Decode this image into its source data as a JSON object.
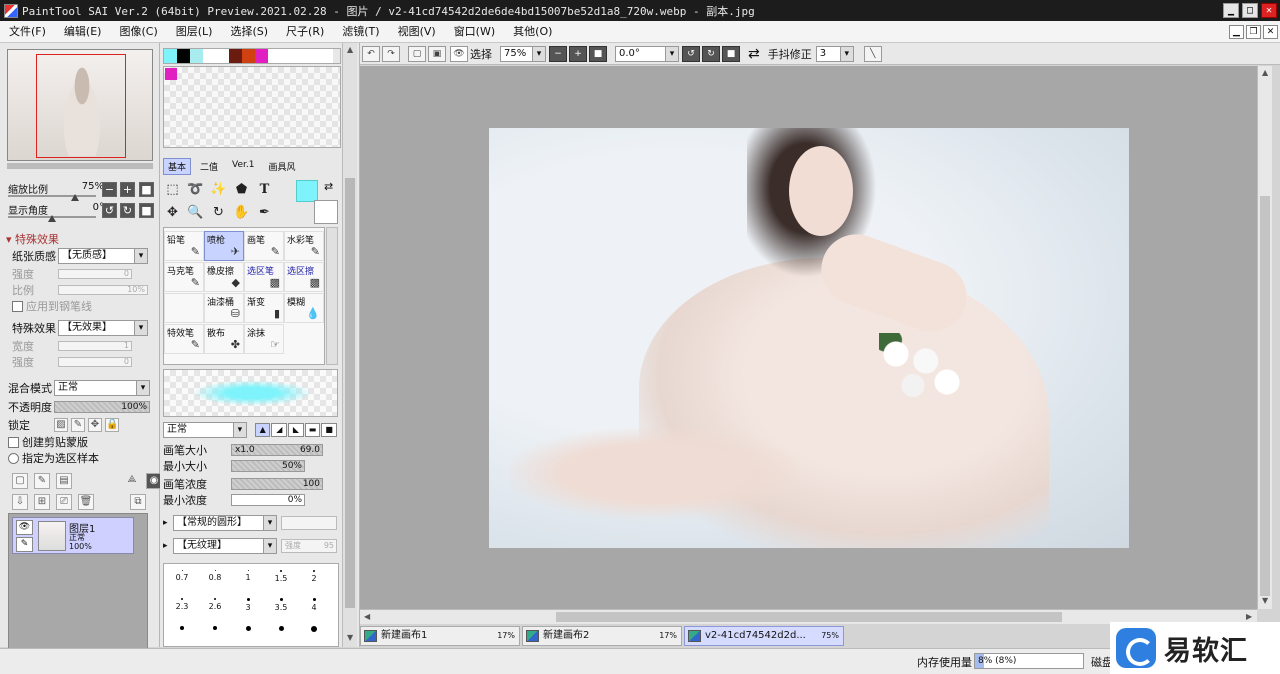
{
  "window": {
    "title": "PaintTool SAI Ver.2 (64bit) Preview.2021.02.28 - 图片 / v2-41cd74542d2de6de4bd15007be52d1a8_720w.webp - 副本.jpg",
    "minimize": "▁",
    "maximize": "□",
    "close": "✕"
  },
  "menu": {
    "items": [
      "文件(F)",
      "编辑(E)",
      "图像(C)",
      "图层(L)",
      "选择(S)",
      "尺子(R)",
      "滤镜(T)",
      "视图(V)",
      "窗口(W)",
      "其他(O)"
    ]
  },
  "navigator": {
    "zoom_label": "缩放比例",
    "zoom_value": "75%",
    "zoom_level": 0.75,
    "angle_label": "显示角度",
    "angle_value": "0°"
  },
  "effects": {
    "section_title": "特殊效果",
    "paper_label": "纸张质感",
    "paper_value": "【无质感】",
    "strength_label": "强度",
    "strength_value": "0",
    "scale_label": "比例",
    "scale_value": "10%",
    "apply_pen_label": "应用到钢笔线",
    "effect_label": "特殊效果",
    "effect_value": "【无效果】",
    "width_label": "宽度",
    "width_value": "1",
    "effect_strength_label": "强度",
    "effect_strength_value": "0"
  },
  "layer_props": {
    "blend_label": "混合模式",
    "blend_value": "正常",
    "opacity_label": "不透明度",
    "opacity_value": "100%",
    "opacity_level": 1.0,
    "lock_label": "锁定",
    "clip_label": "创建剪贴蒙版",
    "sample_label": "指定为选区样本"
  },
  "layers": [
    {
      "name": "图层1",
      "mode": "正常",
      "opacity": "100%"
    }
  ],
  "palette": {
    "colors": [
      "#7ff3fb",
      "#000000",
      "#a8ecf0",
      "#ffffff",
      "#ffffff",
      "#6a1c10",
      "#d04010",
      "#e020c0",
      "#ffffff",
      "#ffffff",
      "#ffffff",
      "#ffffff",
      "#ffffff"
    ]
  },
  "tool_tabs": [
    "基本",
    "二值",
    "Ver.1",
    "画具风"
  ],
  "brushes": [
    {
      "label": "铅笔",
      "icon": "✎"
    },
    {
      "label": "喷枪",
      "icon": "✈"
    },
    {
      "label": "画笔",
      "icon": "✎"
    },
    {
      "label": "水彩笔",
      "icon": "✎"
    },
    {
      "label": "马克笔",
      "icon": "✎"
    },
    {
      "label": "橡皮擦",
      "icon": "◆"
    },
    {
      "label": "选区笔",
      "icon": "▩"
    },
    {
      "label": "选区擦",
      "icon": "▩"
    },
    {
      "label": "",
      "icon": ""
    },
    {
      "label": "油漆桶",
      "icon": "⛁"
    },
    {
      "label": "渐变",
      "icon": "▮"
    },
    {
      "label": "模糊",
      "icon": "💧"
    },
    {
      "label": "特效笔",
      "icon": "✎"
    },
    {
      "label": "散布",
      "icon": "✤"
    },
    {
      "label": "涂抹",
      "icon": "☞"
    }
  ],
  "brush_settings": {
    "mode_value": "正常",
    "size_label": "画笔大小",
    "size_multiplier": "x1.0",
    "size_value": "69.0",
    "min_size_label": "最小大小",
    "min_size_value": "50%",
    "density_label": "画笔浓度",
    "density_value": "100",
    "min_density_label": "最小浓度",
    "min_density_value": "0%",
    "shape_value": "【常规的圆形】",
    "texture_value": "【无纹理】",
    "texture_strength_label": "强度",
    "texture_strength_value": "95"
  },
  "brush_dots": [
    {
      "label": "0.7",
      "size": 1
    },
    {
      "label": "0.8",
      "size": 1
    },
    {
      "label": "1",
      "size": 1
    },
    {
      "label": "1.5",
      "size": 2
    },
    {
      "label": "2",
      "size": 2
    },
    {
      "label": "2.3",
      "size": 2
    },
    {
      "label": "2.6",
      "size": 2
    },
    {
      "label": "3",
      "size": 3
    },
    {
      "label": "3.5",
      "size": 3
    },
    {
      "label": "4",
      "size": 3
    },
    {
      "label": "",
      "size": 4
    },
    {
      "label": "",
      "size": 4
    },
    {
      "label": "",
      "size": 5
    },
    {
      "label": "",
      "size": 5
    },
    {
      "label": "",
      "size": 6
    }
  ],
  "toolbar": {
    "select_label": "选择",
    "zoom_value": "75%",
    "angle_value": "0.0°",
    "stabilizer_label": "手抖修正",
    "stabilizer_value": "3"
  },
  "documents": [
    {
      "name": "新建画布1",
      "zoom": "17%",
      "active": false
    },
    {
      "name": "新建画布2",
      "zoom": "17%",
      "active": false
    },
    {
      "name": "v2-41cd74542d2d...",
      "zoom": "75%",
      "active": true
    }
  ],
  "status": {
    "memory_label": "内存使用量",
    "memory_value": "8% (8%)",
    "memory_level": 0.08,
    "disk_label": "磁盘"
  },
  "watermark": {
    "text": "易软汇"
  }
}
